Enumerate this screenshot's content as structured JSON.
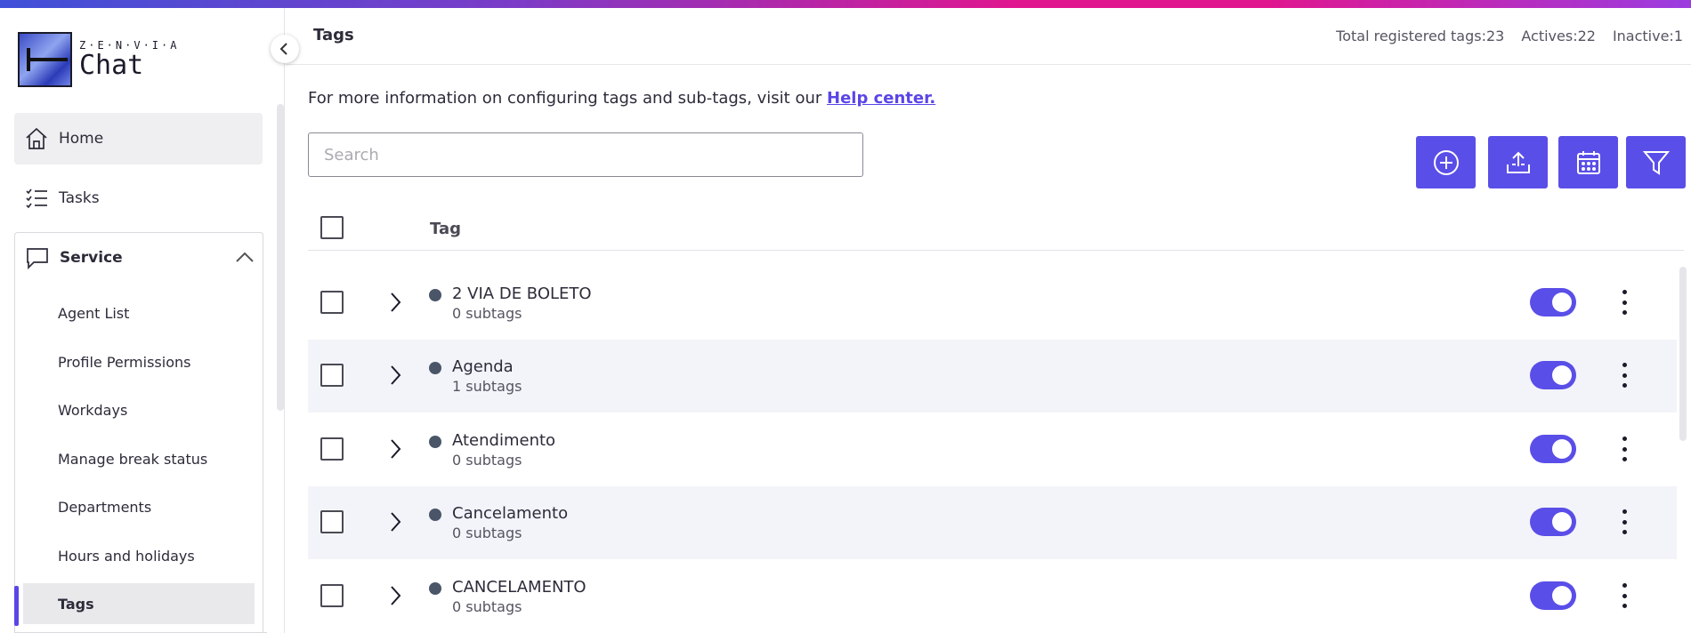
{
  "brand": {
    "small": "Z·E·N·V·I·A",
    "name": "Chat",
    "accent": "#5a4ee8"
  },
  "sidebar": {
    "items": [
      {
        "label": "Home",
        "icon": "home-icon"
      },
      {
        "label": "Tasks",
        "icon": "tasks-icon"
      }
    ],
    "service": {
      "label": "Service",
      "icon": "chat-bubble-icon",
      "children": [
        {
          "label": "Agent List"
        },
        {
          "label": "Profile Permissions"
        },
        {
          "label": "Workdays"
        },
        {
          "label": "Manage break status"
        },
        {
          "label": "Departments"
        },
        {
          "label": "Hours and holidays"
        },
        {
          "label": "Tags"
        }
      ]
    }
  },
  "header": {
    "title": "Tags",
    "total": "Total registered tags:23",
    "actives": "Actives:22",
    "inactive": "Inactive:1"
  },
  "info": {
    "text": "For more information on configuring tags and sub-tags, visit our ",
    "link": "Help center."
  },
  "search": {
    "placeholder": "Search",
    "value": ""
  },
  "actions": [
    "add-icon",
    "upload-icon",
    "calendar-icon",
    "filter-icon"
  ],
  "table": {
    "column_tag": "Tag",
    "rows": [
      {
        "name": "2 VIA DE BOLETO",
        "subtags": "0 subtags",
        "active": true
      },
      {
        "name": "Agenda",
        "subtags": "1 subtags",
        "active": true
      },
      {
        "name": "Atendimento",
        "subtags": "0 subtags",
        "active": true
      },
      {
        "name": "Cancelamento",
        "subtags": "0 subtags",
        "active": true
      },
      {
        "name": "CANCELAMENTO",
        "subtags": "0 subtags",
        "active": true
      }
    ]
  }
}
